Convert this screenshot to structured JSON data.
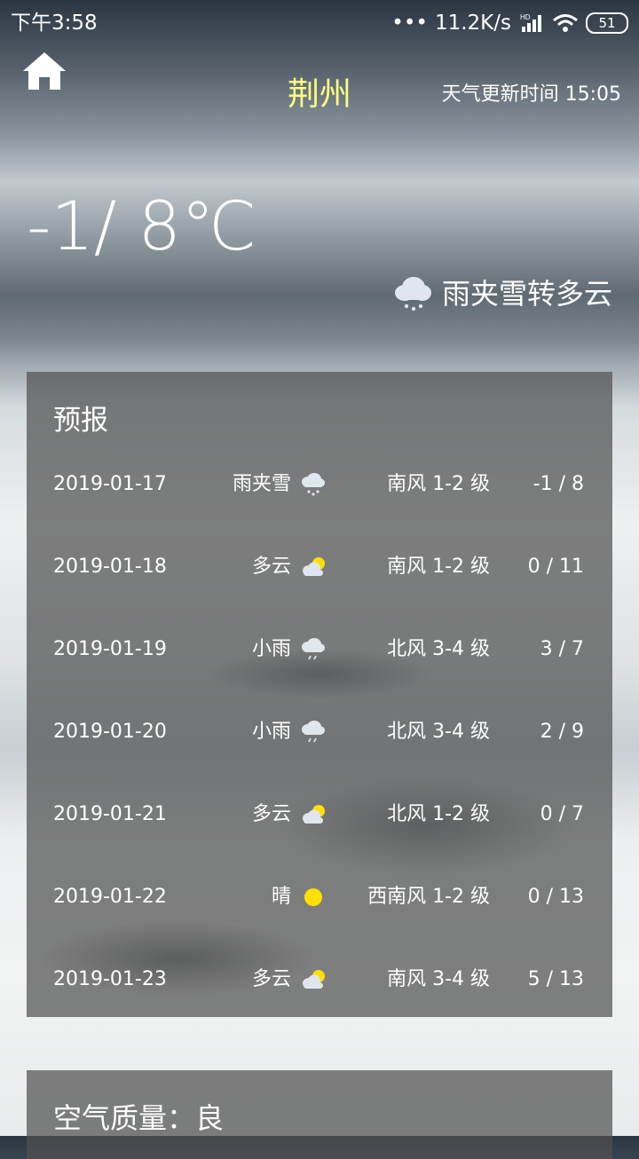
{
  "status": {
    "time": "下午3:58",
    "dots": "•••",
    "speed": "11.2K/s",
    "battery": "51"
  },
  "header": {
    "city": "荆州",
    "update_time": "天气更新时间 15:05"
  },
  "current": {
    "temperature": "-1/ 8℃",
    "condition": "雨夹雪转多云",
    "icon": "sleet-icon"
  },
  "forecast": {
    "title": "预报",
    "days": [
      {
        "date": "2019-01-17",
        "desc": "雨夹雪",
        "icon": "sleet-icon",
        "wind": "南风 1-2 级",
        "range": "-1 / 8"
      },
      {
        "date": "2019-01-18",
        "desc": "多云",
        "icon": "partly-cloudy-icon",
        "wind": "南风 1-2 级",
        "range": "0 / 11"
      },
      {
        "date": "2019-01-19",
        "desc": "小雨",
        "icon": "light-rain-icon",
        "wind": "北风 3-4 级",
        "range": "3 / 7"
      },
      {
        "date": "2019-01-20",
        "desc": "小雨",
        "icon": "light-rain-icon",
        "wind": "北风 3-4 级",
        "range": "2 / 9"
      },
      {
        "date": "2019-01-21",
        "desc": "多云",
        "icon": "partly-cloudy-icon",
        "wind": "北风 1-2 级",
        "range": "0 / 7"
      },
      {
        "date": "2019-01-22",
        "desc": "晴",
        "icon": "sunny-icon",
        "wind": "西南风 1-2 级",
        "range": "0 / 13"
      },
      {
        "date": "2019-01-23",
        "desc": "多云",
        "icon": "partly-cloudy-icon",
        "wind": "南风 3-4 级",
        "range": "5 / 13"
      }
    ]
  },
  "air_quality": {
    "title": "空气质量：良"
  },
  "colors": {
    "city": "#ffff80",
    "card": "#505050",
    "sun": "#ffe000"
  }
}
